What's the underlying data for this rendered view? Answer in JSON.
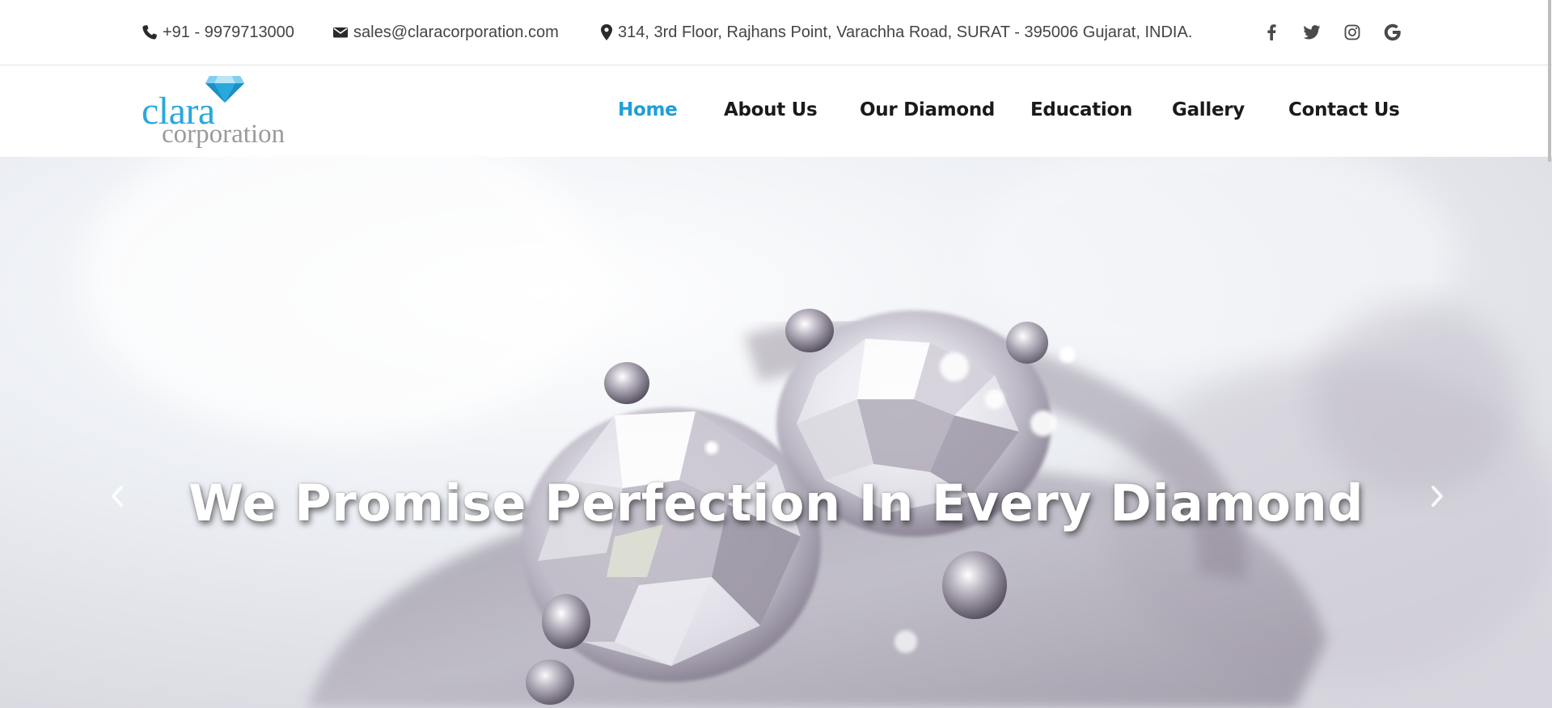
{
  "topbar": {
    "phone": "+91 - 9979713000",
    "email": "sales@claracorporation.com",
    "address": "314, 3rd Floor, Rajhans Point, Varachha Road, SURAT - 395006 Gujarat, INDIA.",
    "icons": {
      "phone": "phone-icon",
      "email": "envelope-icon",
      "address": "map-marker-icon"
    },
    "social": [
      "facebook-icon",
      "twitter-icon",
      "instagram-icon",
      "google-icon"
    ]
  },
  "logo": {
    "primary": "clara",
    "secondary": "corporation"
  },
  "nav": {
    "items": [
      {
        "label": "Home",
        "active": true
      },
      {
        "label": "About Us",
        "active": false
      },
      {
        "label": "Our Diamond",
        "active": false
      },
      {
        "label": "Education",
        "active": false
      },
      {
        "label": "Gallery",
        "active": false
      },
      {
        "label": "Contact Us",
        "active": false
      }
    ]
  },
  "hero": {
    "title": "We Promise Perfection In Every Diamond",
    "prev_icon": "chevron-left-icon",
    "next_icon": "chevron-right-icon"
  },
  "colors": {
    "accent": "#1d9fd8",
    "logo_blue": "#29a8dc",
    "logo_grey": "#9a9a9a",
    "text_dark": "#1a1a1a",
    "text_muted": "#444444"
  }
}
